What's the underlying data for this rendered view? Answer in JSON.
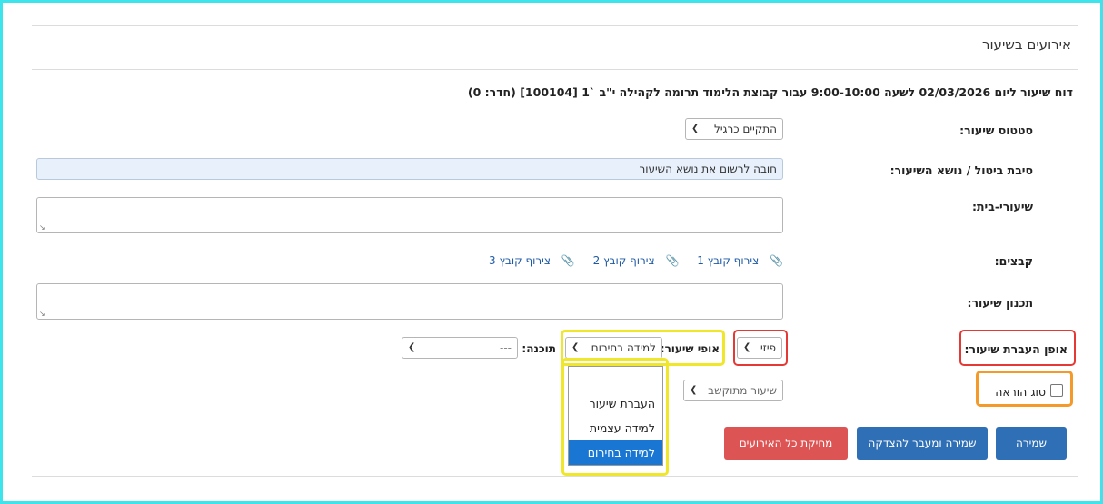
{
  "section_title": "אירועים בשיעור",
  "report_line": "דוח שיעור ליום 02/03/2026 לשעה 9:00-10:00 עבור קבוצת הלימוד תרומה לקהילה י\"ב `1 [100104] (חדר: 0)",
  "labels": {
    "status": "סטטוס שיעור:",
    "reason": "סיבת ביטול / נושא השיעור:",
    "homework": "שיעורי-בית:",
    "files": "קבצים:",
    "planning": "תכנון שיעור:",
    "delivery_mode": "אופן העברת שיעור:",
    "lesson_nature": "אופי שיעור:",
    "program": "תוכנה:",
    "teaching_type": "סוג הוראה"
  },
  "fields": {
    "status_value": "התקיים כרגיל",
    "reason_value": "חובה לרשום את נושא השיעור",
    "delivery_mode_value": "פיזי",
    "lesson_nature_value": "למידה בחירום",
    "program_value": "---",
    "computerized_value": "שיעור מתוקשב"
  },
  "files": [
    "צירוף קובץ 1",
    "צירוף קובץ 2",
    "צירוף קובץ 3"
  ],
  "lesson_nature_options": [
    "---",
    "העברת שיעור",
    "למידה עצמית",
    "למידה בחירום"
  ],
  "buttons": {
    "save": "שמירה",
    "save_and_approve": "שמירה ומעבר להצדקה",
    "delete_all": "מחיקת כל האירועים"
  },
  "colors": {
    "frame": "#3ee4ec",
    "highlight_red": "#e53935",
    "highlight_yellow": "#f0e62a",
    "highlight_orange": "#f39a2b",
    "primary_button": "#2f6fb5",
    "danger_button": "#dc5554",
    "selected_option": "#1976d2"
  },
  "icons": {
    "chevron": "chevron-down-icon",
    "paperclip": "paperclip-icon"
  }
}
